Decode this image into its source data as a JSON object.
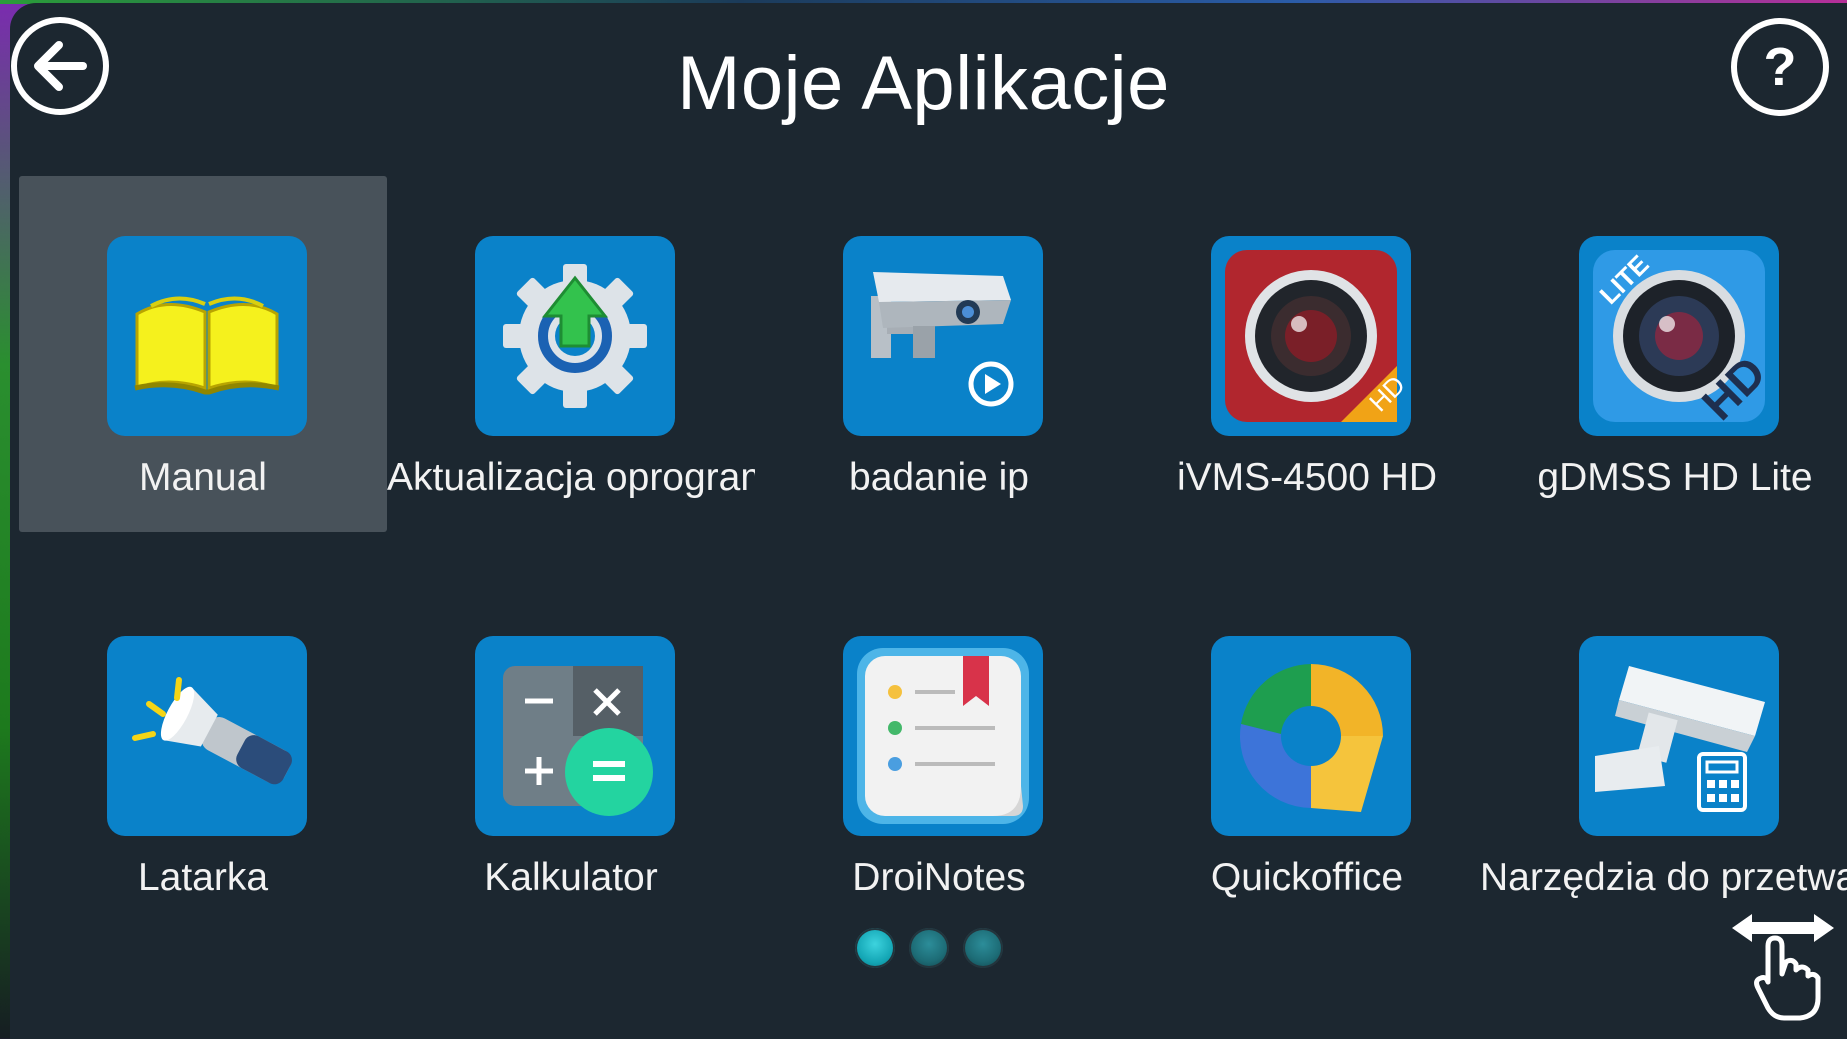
{
  "header": {
    "title": "Moje Aplikacje",
    "back_icon": "arrow-left-icon",
    "help_label": "?"
  },
  "apps": [
    {
      "label": "Manual",
      "icon": "book-icon",
      "selected": true
    },
    {
      "label": "Aktualizacja oprogramowania",
      "icon": "gear-update-icon"
    },
    {
      "label": "badanie ip",
      "icon": "cctv-camera-play-icon"
    },
    {
      "label": "iVMS-4500 HD",
      "icon": "camera-lens-hd-icon"
    },
    {
      "label": "gDMSS HD Lite",
      "icon": "camera-lens-hd-lite-icon"
    },
    {
      "label": "Latarka",
      "icon": "flashlight-icon"
    },
    {
      "label": "Kalkulator",
      "icon": "calculator-icon"
    },
    {
      "label": "DroiNotes",
      "icon": "notes-icon"
    },
    {
      "label": "Quickoffice",
      "icon": "quickoffice-icon"
    },
    {
      "label": "Narzędzia do przetwarzania",
      "icon": "camera-calculator-icon"
    }
  ],
  "pagination": {
    "pages": 3,
    "current": 1
  },
  "swipe_hint_icon": "swipe-hand-icon",
  "colors": {
    "background": "#1c2730",
    "tile": "#0a82c9",
    "selected": "#48525a",
    "accent": "#13a5b4"
  }
}
